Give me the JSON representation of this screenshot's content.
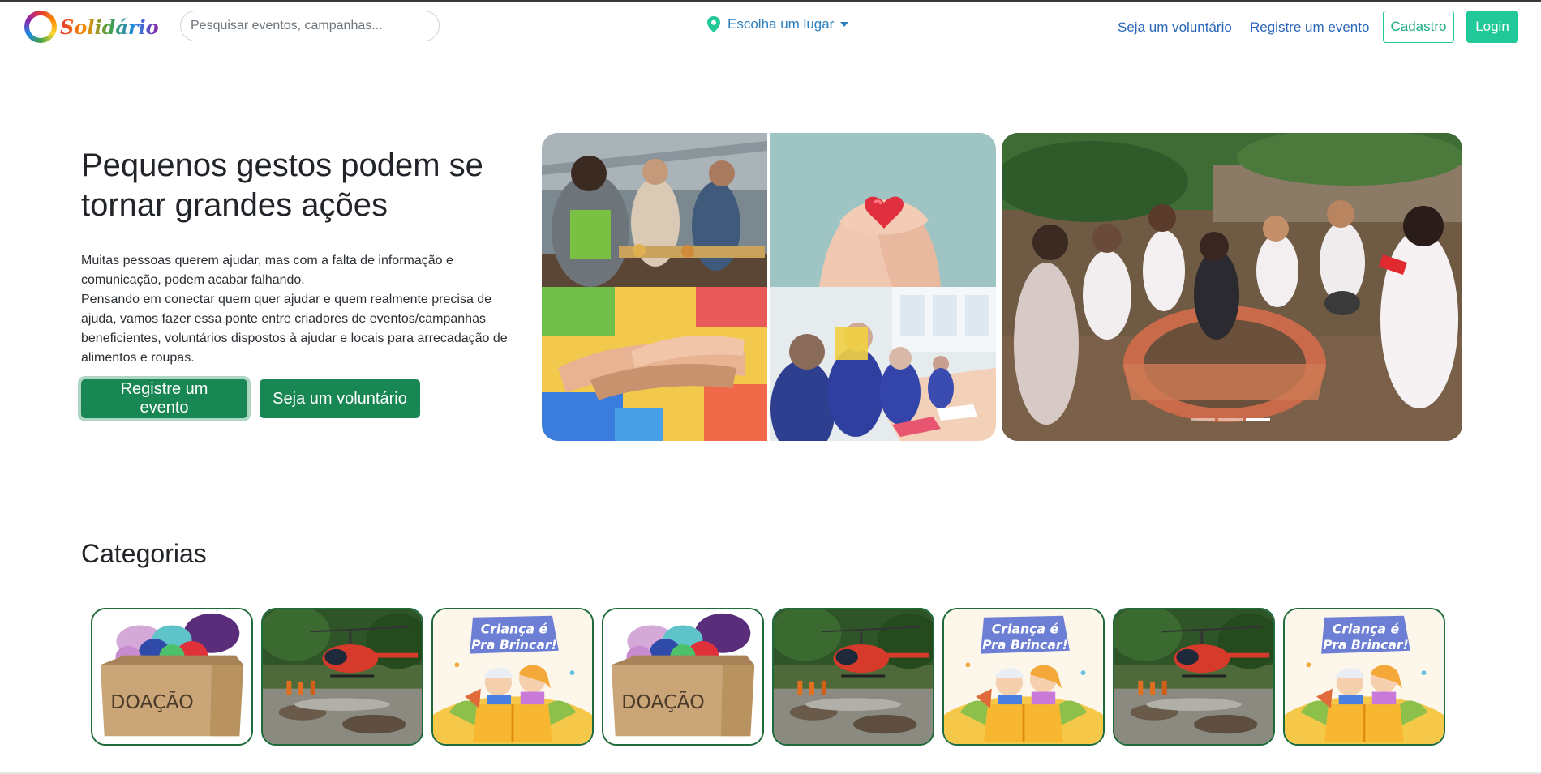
{
  "brand": {
    "name": "Solidário"
  },
  "nav": {
    "search_placeholder": "Pesquisar eventos, campanhas...",
    "location_label": "Escolha um lugar",
    "volunteer_link": "Seja um voluntário",
    "register_link": "Registre um evento",
    "signup_button": "Cadastro",
    "login_button": "Login"
  },
  "hero": {
    "title": "Pequenos gestos podem se tornar grandes ações",
    "paragraph_1": "Muitas pessoas querem ajudar, mas com a falta de informação e comunicação, podem acabar falhando.",
    "paragraph_2": "Pensando em conectar quem quer ajudar e quem realmente precisa de ajuda, vamos fazer essa ponte entre criadores de eventos/campanhas beneficientes, voluntários dispostos à ajudar e locais para arrecadação de alimentos e roupas.",
    "register_button": "Registre um evento",
    "volunteer_button": "Seja um voluntário"
  },
  "gallery": {
    "images": [
      "volunteers-serving-food",
      "hands-holding-heart",
      "stacked-hands-over-blocks",
      "elderly-group-crafts"
    ],
    "carousel": {
      "image": "kids-building-brick-garden",
      "slide_count": 3,
      "active_slide": 3
    }
  },
  "categories": {
    "title": "Categorias",
    "items": [
      {
        "image": "donation-box",
        "box_text": "DOAÇÃO"
      },
      {
        "image": "rescue-helicopter"
      },
      {
        "image": "children-play",
        "banner_text": "Criança é Pra Brincar!"
      },
      {
        "image": "donation-box",
        "box_text": "DOAÇÃO"
      },
      {
        "image": "rescue-helicopter"
      },
      {
        "image": "children-play",
        "banner_text": "Criança é Pra Brincar!"
      },
      {
        "image": "rescue-helicopter"
      },
      {
        "image": "children-play",
        "banner_text": "Criança é Pra Brincar!"
      }
    ]
  },
  "colors": {
    "primary_green": "#198754",
    "teal": "#20c997",
    "link_blue": "#2a66b8",
    "card_border": "#1d6b3a"
  }
}
